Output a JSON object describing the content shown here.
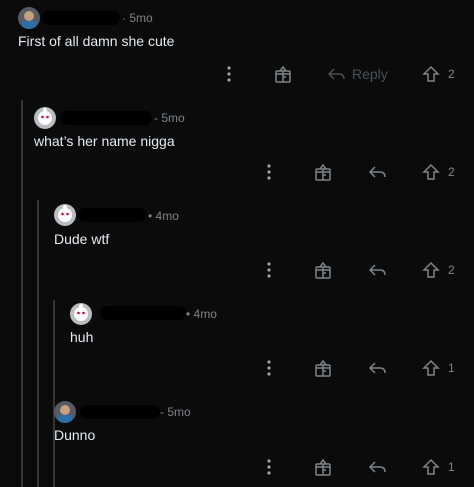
{
  "comments": [
    {
      "age": "5mo",
      "text": "First of all damn she cute",
      "reply_label": "Reply",
      "votes": "2"
    },
    {
      "age": "5mo",
      "text": "what’s her name nigga",
      "votes": "2"
    },
    {
      "age": "4mo",
      "text": "Dude wtf",
      "votes": "2"
    },
    {
      "age": "4mo",
      "text": "huh",
      "votes": "1"
    },
    {
      "age": "5mo",
      "text": "Dunno",
      "votes": "1"
    }
  ],
  "icons": {
    "more": "more-options-icon",
    "award": "award-icon",
    "reply": "reply-icon",
    "upvote": "upvote-icon"
  },
  "colors": {
    "background": "#0b0b0c",
    "text": "#e8eaec",
    "muted": "#818384",
    "thread_line": "#343536"
  }
}
